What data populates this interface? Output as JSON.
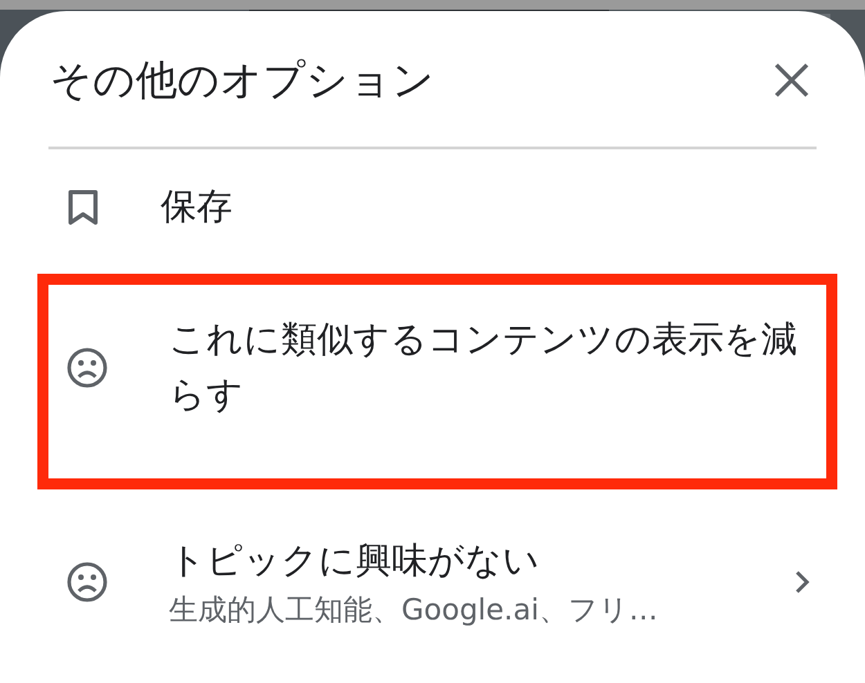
{
  "sheet": {
    "title": "その他のオプション"
  },
  "items": [
    {
      "kind": "save",
      "label": "保存",
      "highlighted": false
    },
    {
      "kind": "less",
      "label": "これに類似するコンテンツの表示を減らす",
      "highlighted": true
    },
    {
      "kind": "topic",
      "label": "トピックに興味がない",
      "subtitle": "生成的人工知能、Google.ai、フリ…",
      "highlighted": false
    }
  ]
}
